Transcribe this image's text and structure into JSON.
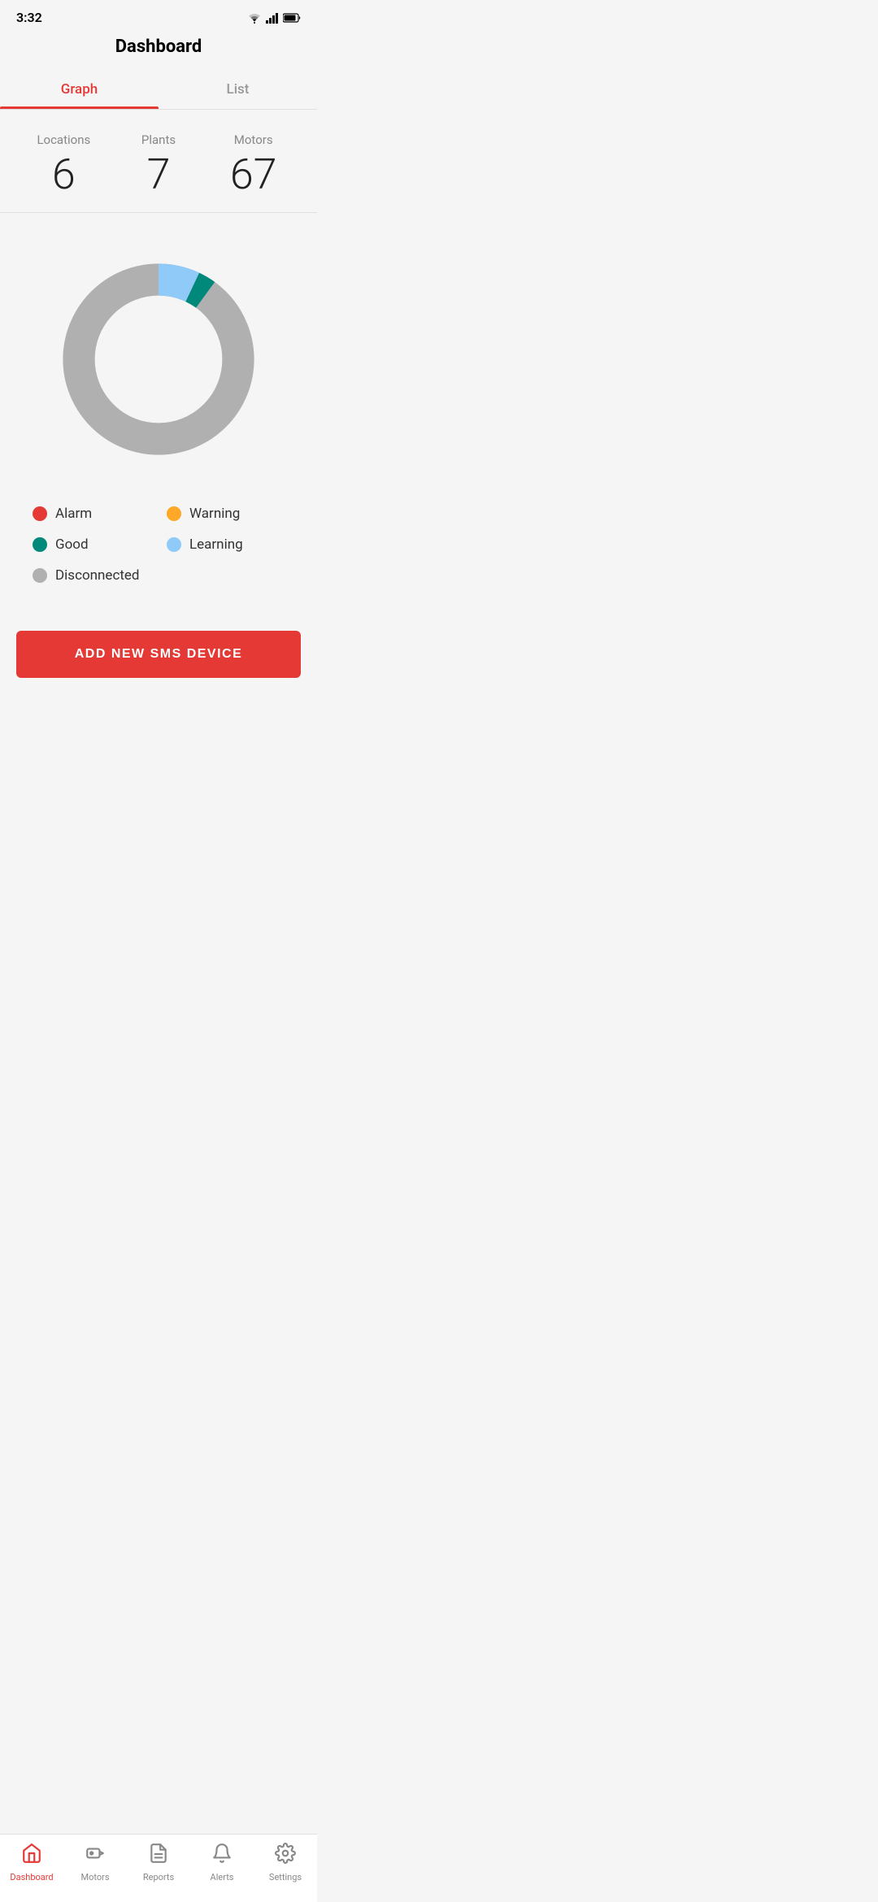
{
  "statusBar": {
    "time": "3:32",
    "icons": [
      "wifi",
      "signal",
      "battery"
    ]
  },
  "header": {
    "title": "Dashboard"
  },
  "tabs": [
    {
      "label": "Graph",
      "active": true,
      "id": "graph"
    },
    {
      "label": "List",
      "active": false,
      "id": "list"
    }
  ],
  "stats": [
    {
      "label": "Locations",
      "value": "6"
    },
    {
      "label": "Plants",
      "value": "7"
    },
    {
      "label": "Motors",
      "value": "67"
    }
  ],
  "chart": {
    "segments": [
      {
        "name": "Disconnected",
        "color": "#b0b0b0",
        "percent": 85
      },
      {
        "name": "Learning",
        "color": "#90caf9",
        "percent": 7
      },
      {
        "name": "Good",
        "color": "#00897b",
        "percent": 3
      },
      {
        "name": "Warning",
        "color": "#ffa726",
        "percent": 0
      },
      {
        "name": "Alarm",
        "color": "#e53935",
        "percent": 0
      }
    ]
  },
  "legend": [
    {
      "label": "Alarm",
      "color": "#e53935"
    },
    {
      "label": "Warning",
      "color": "#ffa726"
    },
    {
      "label": "Good",
      "color": "#00897b"
    },
    {
      "label": "Learning",
      "color": "#90caf9"
    },
    {
      "label": "Disconnected",
      "color": "#b0b0b0"
    }
  ],
  "addButton": {
    "label": "ADD NEW SMS DEVICE"
  },
  "bottomNav": [
    {
      "label": "Dashboard",
      "active": true,
      "id": "dashboard"
    },
    {
      "label": "Motors",
      "active": false,
      "id": "motors"
    },
    {
      "label": "Reports",
      "active": false,
      "id": "reports"
    },
    {
      "label": "Alerts",
      "active": false,
      "id": "alerts"
    },
    {
      "label": "Settings",
      "active": false,
      "id": "settings"
    }
  ]
}
